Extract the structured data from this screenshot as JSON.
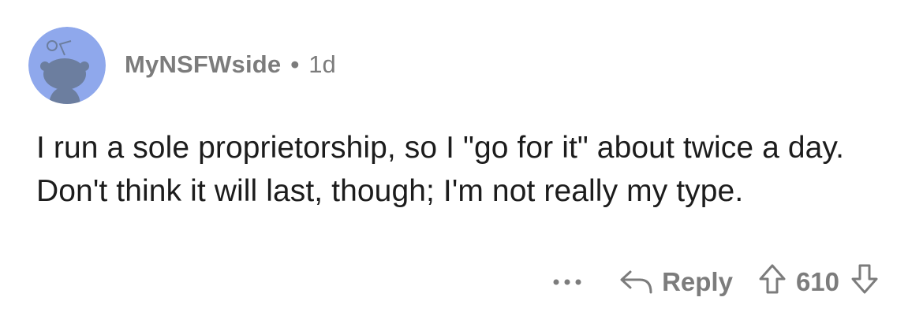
{
  "comment": {
    "author": "MyNSFWside",
    "separator": "•",
    "age": "1d",
    "body": "I run a sole proprietorship, so I \"go for it\" about twice a day. Don't think it will last, though; I'm not really my type.",
    "avatar_icon": "reddit-snoo-avatar-icon"
  },
  "actions": {
    "more_icon": "more-options-icon",
    "reply_icon": "reply-arrow-icon",
    "reply_label": "Reply",
    "upvote_icon": "upvote-arrow-icon",
    "score": "610",
    "downvote_icon": "downvote-arrow-icon"
  },
  "colors": {
    "avatar_bg": "#8fa8ec",
    "avatar_figure": "#6c7e9f",
    "meta_text": "#7c7c7c",
    "body_text": "#1c1c1c"
  }
}
